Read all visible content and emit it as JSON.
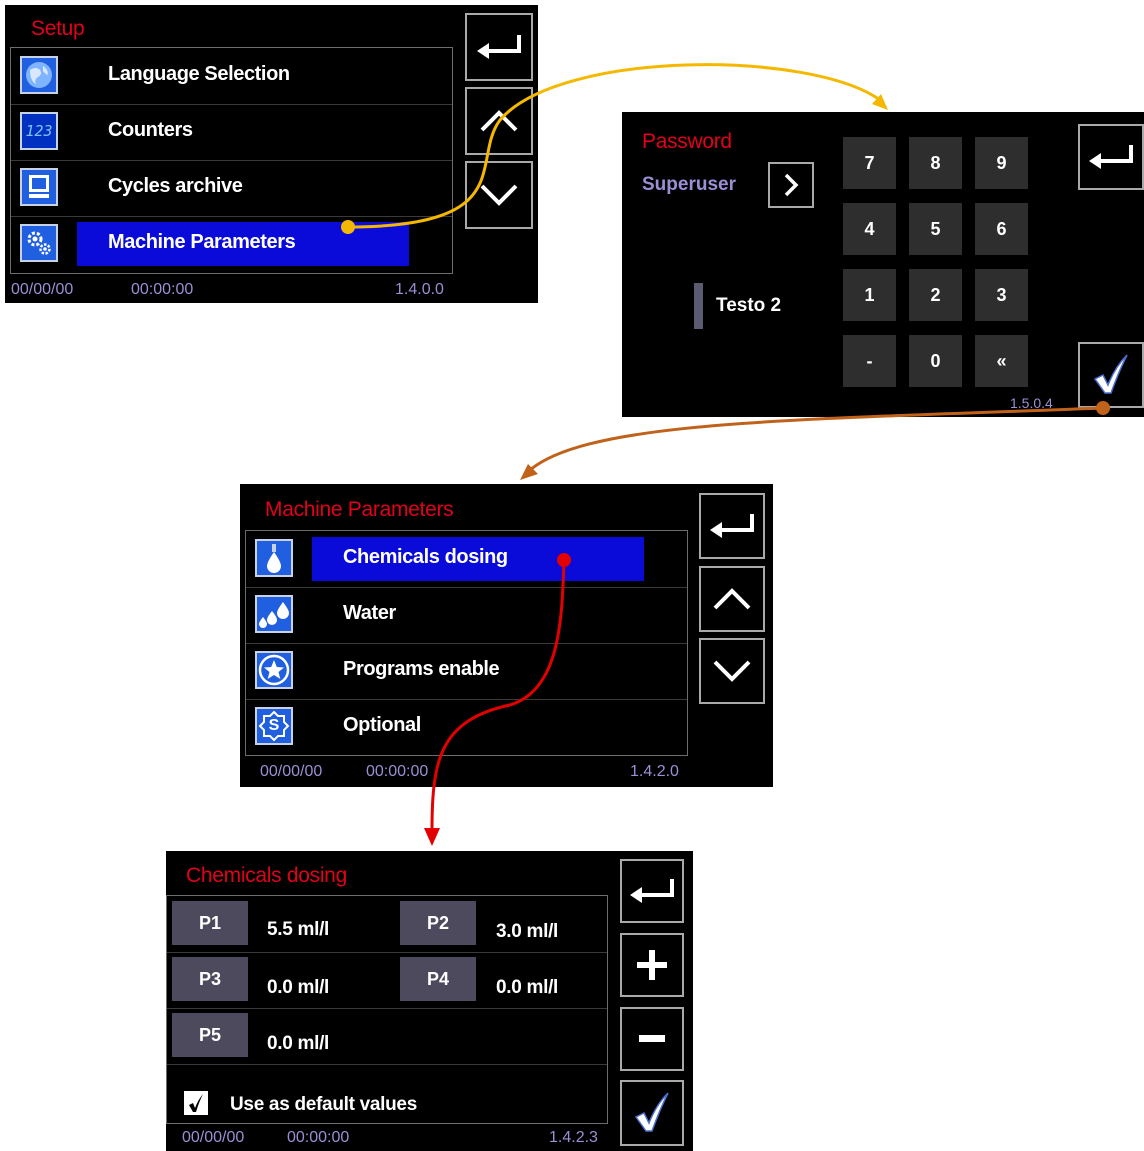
{
  "setup": {
    "title": "Setup",
    "items": [
      {
        "label": "Language Selection",
        "icon": "globe-icon"
      },
      {
        "label": "Counters",
        "icon": "counter-123-icon",
        "icon_text": "123"
      },
      {
        "label": "Cycles archive",
        "icon": "monitor-icon"
      },
      {
        "label": "Machine Parameters",
        "icon": "gears-icon",
        "selected": true
      }
    ],
    "date": "00/00/00",
    "time": "00:00:00",
    "version": "1.4.0.0"
  },
  "password": {
    "title": "Password",
    "user": "Superuser",
    "field_text": "Testo 2",
    "keys": [
      "7",
      "8",
      "9",
      "4",
      "5",
      "6",
      "1",
      "2",
      "3",
      "-",
      "0",
      "«"
    ],
    "version": "1.5.0.4"
  },
  "machine_params": {
    "title": "Machine Parameters",
    "items": [
      {
        "label": "Chemicals dosing",
        "icon": "drop-icon",
        "selected": true
      },
      {
        "label": "Water",
        "icon": "water-drops-icon"
      },
      {
        "label": "Programs enable",
        "icon": "star-icon"
      },
      {
        "label": "Optional",
        "icon": "optional-s-icon",
        "icon_text": "S"
      }
    ],
    "date": "00/00/00",
    "time": "00:00:00",
    "version": "1.4.2.0"
  },
  "chemicals": {
    "title": "Chemicals dosing",
    "pumps": [
      {
        "label": "P1",
        "value": "5.5 ml/l"
      },
      {
        "label": "P2",
        "value": "3.0 ml/l"
      },
      {
        "label": "P3",
        "value": "0.0 ml/l"
      },
      {
        "label": "P4",
        "value": "0.0 ml/l"
      },
      {
        "label": "P5",
        "value": "0.0 ml/l"
      }
    ],
    "default_label": "Use as default values",
    "default_checked": true,
    "date": "00/00/00",
    "time": "00:00:00",
    "version": "1.4.2.3"
  },
  "colors": {
    "title_red": "#e3001b",
    "select_blue": "#0b0bd9",
    "icon_blue": "#1f5fe0",
    "status_purple": "#9a8fd4",
    "arrow_yellow": "#f5b800",
    "arrow_brown": "#c0621a",
    "arrow_red": "#e30000"
  }
}
